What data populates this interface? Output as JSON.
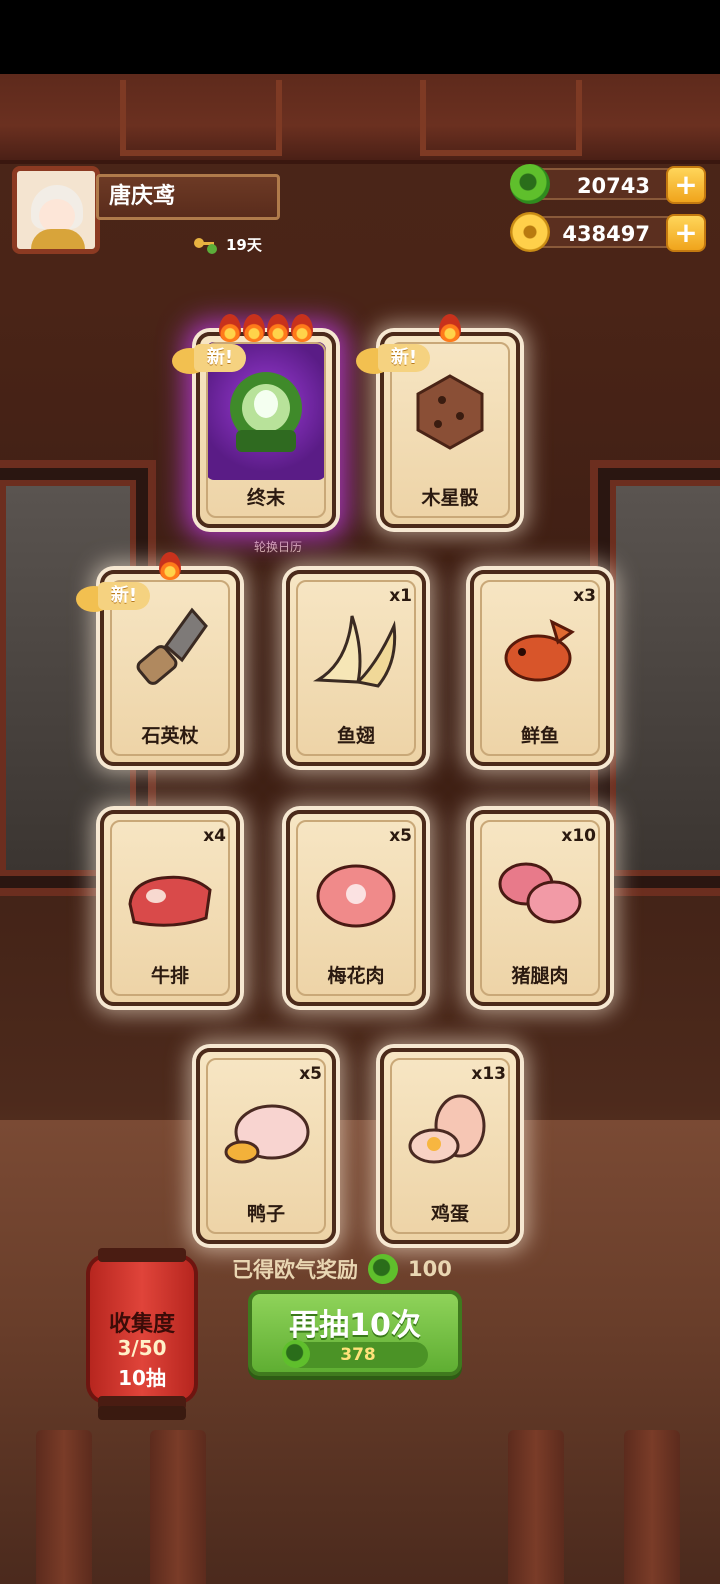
{
  "player": {
    "name": "唐庆鸢",
    "days": "19天"
  },
  "currency": {
    "jade": "20743",
    "coins": "438497",
    "plus": "+"
  },
  "badge_new": "新!",
  "rotation_label": "轮换日历",
  "cards": [
    {
      "name": "终末",
      "qty": "",
      "new": true,
      "flames": 4
    },
    {
      "name": "木星骰",
      "qty": "",
      "new": true,
      "flames": 1
    },
    {
      "name": "石英杖",
      "qty": "",
      "new": true,
      "flames": 1
    },
    {
      "name": "鱼翅",
      "qty": "x1"
    },
    {
      "name": "鲜鱼",
      "qty": "x3"
    },
    {
      "name": "牛排",
      "qty": "x4"
    },
    {
      "name": "梅花肉",
      "qty": "x5"
    },
    {
      "name": "猪腿肉",
      "qty": "x10"
    },
    {
      "name": "鸭子",
      "qty": "x5"
    },
    {
      "name": "鸡蛋",
      "qty": "x13"
    }
  ],
  "reward": {
    "label": "已得欧气奖励",
    "amount": "100"
  },
  "draw_button": {
    "label": "再抽10次",
    "cost": "378"
  },
  "collection": {
    "title": "收集度",
    "progress": "3/50",
    "draws": "10抽"
  },
  "colors": {
    "accent_green": "#5fae32",
    "card_bg": "#f7e6c4",
    "lantern_red": "#e0443a"
  }
}
